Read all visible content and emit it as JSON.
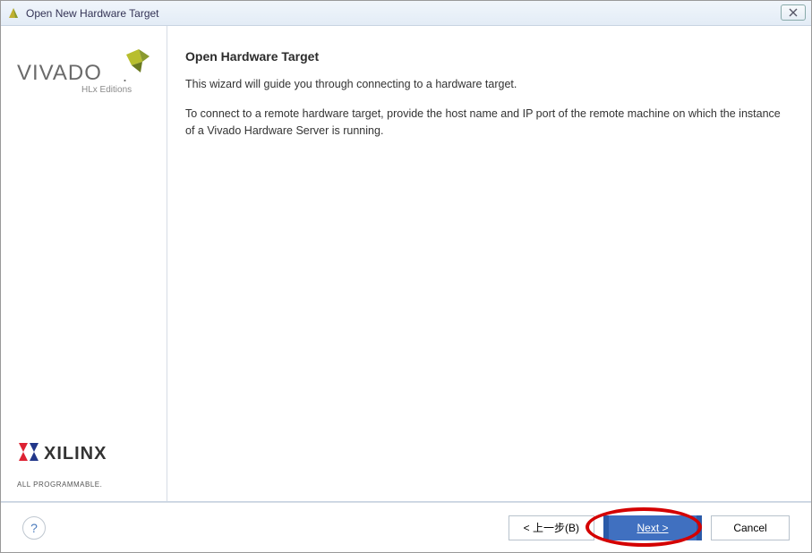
{
  "window": {
    "title": "Open New Hardware Target"
  },
  "sidebar": {
    "vivado_alt": "VIVADO HLx Editions",
    "xilinx_alt": "XILINX",
    "all_programmable": "ALL PROGRAMMABLE."
  },
  "main": {
    "heading": "Open Hardware Target",
    "para1": "This wizard will guide you through connecting to a hardware target.",
    "para2": "To connect to a remote hardware target, provide the host name and IP port of the remote machine on which the instance of a Vivado Hardware Server is running."
  },
  "footer": {
    "help": "?",
    "back": "< 上一步(B)",
    "next_prefix": "N",
    "next_rest": "ext >",
    "cancel": "Cancel"
  }
}
